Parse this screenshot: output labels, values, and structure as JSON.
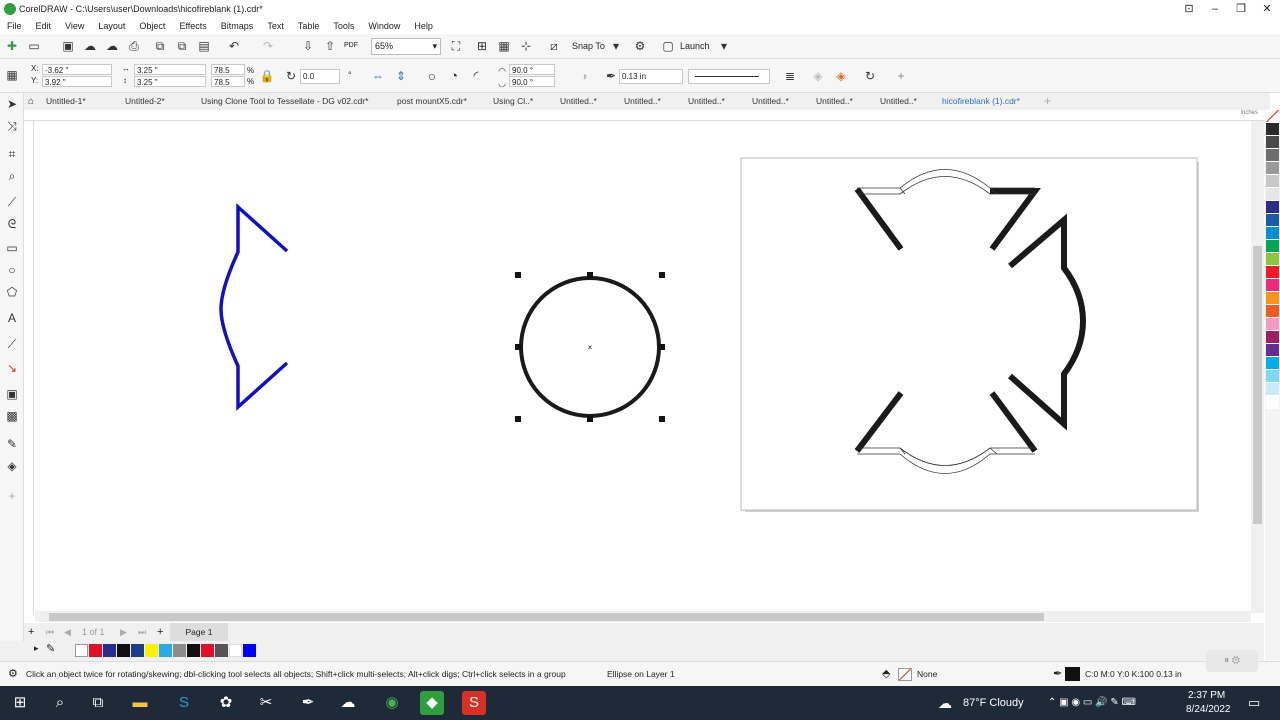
{
  "window": {
    "title": "CorelDRAW - C:\\Users\\user\\Downloads\\hicofireblank (1).cdr*"
  },
  "menu": [
    "File",
    "Edit",
    "View",
    "Layout",
    "Object",
    "Effects",
    "Bitmaps",
    "Text",
    "Table",
    "Tools",
    "Window",
    "Help"
  ],
  "toolbar": {
    "zoom": "65%",
    "snap_to": "Snap To",
    "launch": "Launch",
    "pdf": "PDF"
  },
  "properties": {
    "x": "-3.62 \"",
    "y": "3.92 \"",
    "width": "3.25 \"",
    "height": "3.25 \"",
    "scale_w": "78.5",
    "scale_h": "78.5",
    "rotation": "0.0",
    "angle_start": "90.0 °",
    "angle_end": "90.0 °",
    "outline_width": "0.13 in"
  },
  "tabs": [
    "Untitled-1*",
    "Untitled-2*",
    "Using Clone Tool to Tessellate - DG v02.cdr*",
    "post mountX5.cdr*",
    "Using Cl..*",
    "Untitled..*",
    "Untitled..*",
    "Untitled..*",
    "Untitled..*",
    "Untitled..*",
    "Untitled..*",
    "hicofireblank (1).cdr*"
  ],
  "ruler_unit": "inches",
  "pages": {
    "page_of": "1 of 1",
    "page_tab": "Page 1"
  },
  "status": {
    "hint": "Click an object twice for rotating/skewing; dbl-clicking tool selects all objects; Shift+click multi-selects; Alt+click digs; Ctrl+click selects in a group",
    "object_info": "Ellipse on Layer 1",
    "fill": "None",
    "outline": "C:0 M:0 Y:0 K:100  0.13 in"
  },
  "taskbar": {
    "weather": "87°F  Cloudy",
    "time": "2:37 PM",
    "date": "8/24/2022"
  },
  "colors": {
    "accent": "#2c6fb8",
    "shape_blue": "#1010c8",
    "outline_black": "#1a1a1a",
    "palette": [
      "#ffffff",
      "#c8c8c8",
      "#9a9a9a",
      "#6e6e6e",
      "#4a4a4a",
      "#2a2a2a",
      "#ffffff",
      "#2b2d8e",
      "#1e5aa8",
      "#0091d4",
      "#00a651",
      "#8dc63f",
      "#fff200",
      "#ffc20e",
      "#f7941d",
      "#f15a24",
      "#ed1c24",
      "#ee2a7b",
      "#f49ac1",
      "#9e1f63",
      "#662d91",
      "#00aeef",
      "#7fd8f7",
      "#c6ecf9",
      "#ffffff"
    ],
    "doc_palette": [
      "#e10f28",
      "#2b2d8e",
      "#111111",
      "#1a3e8e",
      "#fff200",
      "#29abe2",
      "#8c8c8c",
      "#e10f28",
      "#555555",
      "#ffffff",
      "#0000ff"
    ]
  }
}
